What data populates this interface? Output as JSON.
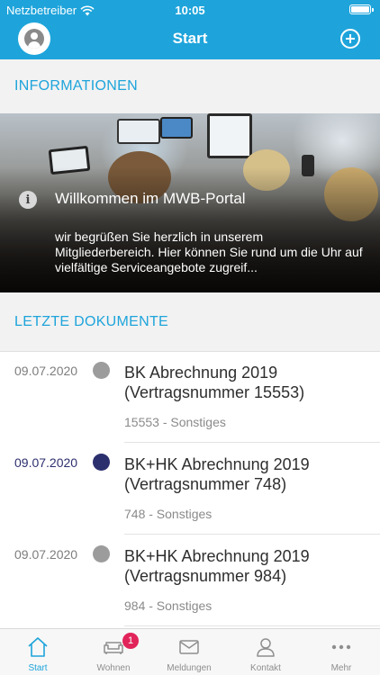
{
  "status_bar": {
    "carrier": "Netzbetreiber",
    "time": "10:05"
  },
  "nav": {
    "title": "Start",
    "left_icon": "avatar-icon",
    "right_icon": "add-circle-icon"
  },
  "info_section": {
    "heading": "INFORMATIONEN",
    "card": {
      "title": "Willkommen im MWB-Portal",
      "text": "wir begrüßen Sie herzlich in unserem Mitgliederbereich. Hier können Sie rund um die Uhr auf vielfältige Serviceangebote zugreif..."
    }
  },
  "documents_section": {
    "heading": "LETZTE DOKUMENTE",
    "items": [
      {
        "date": "09.07.2020",
        "title": "BK Abrechnung 2019 (Vertragsnummer 15553)",
        "meta": "15553 - Sonstiges",
        "unread": false
      },
      {
        "date": "09.07.2020",
        "title": "BK+HK Abrechnung 2019 (Vertragsnummer 748)",
        "meta": "748 - Sonstiges",
        "unread": true
      },
      {
        "date": "09.07.2020",
        "title": "BK+HK Abrechnung 2019 (Vertragsnummer 984)",
        "meta": "984 - Sonstiges",
        "unread": false
      }
    ]
  },
  "tabbar": {
    "tabs": [
      {
        "label": "Start",
        "icon": "home-icon",
        "active": true
      },
      {
        "label": "Wohnen",
        "icon": "sofa-icon",
        "badge": "1"
      },
      {
        "label": "Meldungen",
        "icon": "mail-icon"
      },
      {
        "label": "Kontakt",
        "icon": "person-icon"
      },
      {
        "label": "Mehr",
        "icon": "more-icon"
      }
    ]
  },
  "colors": {
    "accent": "#1ea4db",
    "unread": "#2c2f6e",
    "badge": "#e1245a"
  }
}
